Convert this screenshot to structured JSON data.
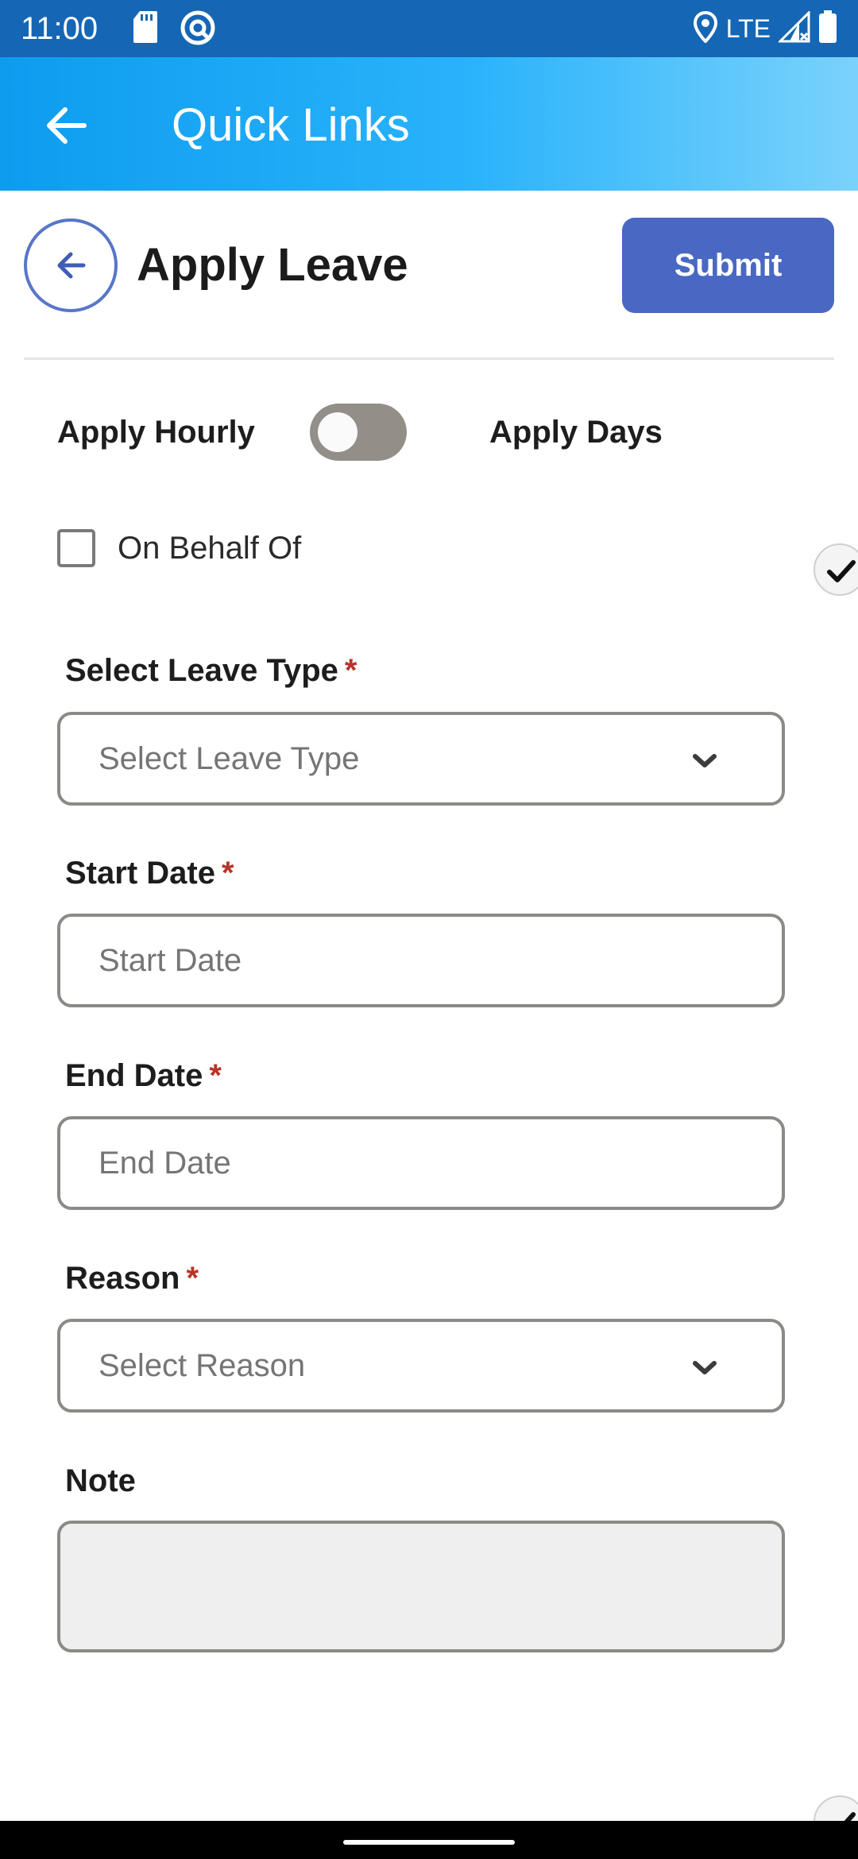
{
  "status_bar": {
    "time": "11:00",
    "network": "LTE",
    "icons": [
      "sd-card-icon",
      "vpn-key-icon",
      "location-pin-icon",
      "signal-icon",
      "battery-icon"
    ]
  },
  "app_bar": {
    "title": "Quick Links",
    "back_icon": "arrow-left-icon"
  },
  "header": {
    "title": "Apply Leave",
    "submit_label": "Submit",
    "back_icon": "arrow-left-circle-icon"
  },
  "toggle": {
    "left_label": "Apply Hourly",
    "right_label": "Apply Days",
    "state": "off"
  },
  "behalf": {
    "label": "On Behalf Of",
    "checked": false
  },
  "form": {
    "leave_type": {
      "label": "Select Leave Type",
      "required_mark": "*",
      "placeholder": "Select Leave Type"
    },
    "start_date": {
      "label": "Start Date",
      "required_mark": "*",
      "placeholder": "Start Date"
    },
    "end_date": {
      "label": "End Date",
      "required_mark": "*",
      "placeholder": "End Date"
    },
    "reason": {
      "label": "Reason",
      "required_mark": "*",
      "placeholder": "Select Reason"
    },
    "note": {
      "label": "Note",
      "value": ""
    }
  },
  "colors": {
    "status_bar": "#1566b5",
    "accent": "#4868c4",
    "app_bar_start": "#0d9cef",
    "app_bar_end": "#7ad2fb",
    "required": "#b8342b"
  }
}
